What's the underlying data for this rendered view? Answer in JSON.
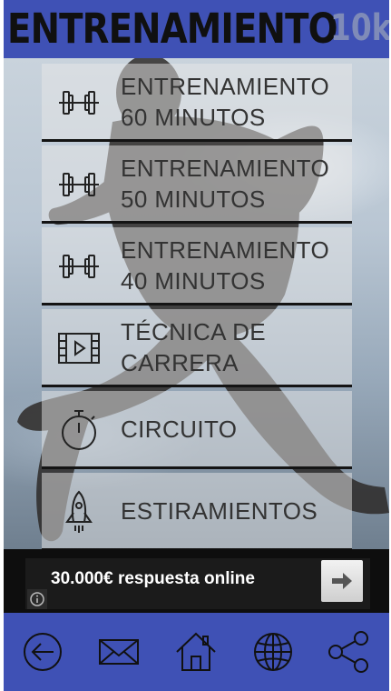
{
  "header": {
    "title": "ENTRENAMIENTO",
    "suffix": "10k"
  },
  "menu": {
    "items": [
      {
        "label": "ENTRENAMIENTO\n60 MINUTOS",
        "icon": "dumbbell-icon"
      },
      {
        "label": "ENTRENAMIENTO\n50 MINUTOS",
        "icon": "dumbbell-icon"
      },
      {
        "label": "ENTRENAMIENTO\n40 MINUTOS",
        "icon": "dumbbell-icon"
      },
      {
        "label": "TÉCNICA DE\nCARRERA",
        "icon": "film-play-icon"
      },
      {
        "label": "CIRCUITO",
        "icon": "stopwatch-icon"
      },
      {
        "label": "ESTIRAMIENTOS",
        "icon": "rocket-icon"
      }
    ]
  },
  "ad": {
    "text": "30.000€ respuesta online",
    "info_icon": "info-icon",
    "arrow_icon": "arrow-right-icon"
  },
  "bottom_nav": {
    "icons": [
      "back-arrow-icon",
      "mail-icon",
      "home-icon",
      "globe-icon",
      "share-icon"
    ]
  },
  "colors": {
    "primary": "#3f51b5",
    "menu_text": "#333333",
    "ad_background": "#0e0e0e"
  }
}
